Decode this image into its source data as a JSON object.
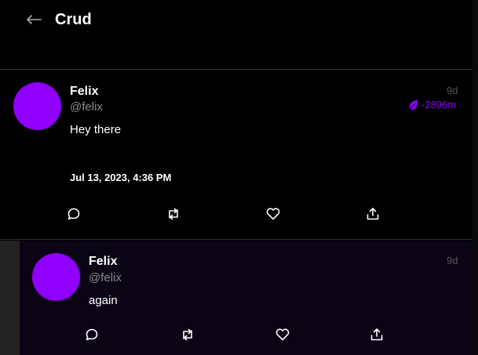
{
  "header": {
    "title": "Crud",
    "back_icon": "arrow-left-icon"
  },
  "post": {
    "author_name": "Felix",
    "author_handle": "@felix",
    "text": "Hey there",
    "age": "9d",
    "score": "-2896m",
    "score_icon": "droplet-icon",
    "timestamp": "Jul 13, 2023, 4:36 PM",
    "actions": [
      "reply-icon",
      "repost-icon",
      "like-icon",
      "share-icon"
    ]
  },
  "reply": {
    "author_name": "Felix",
    "author_handle": "@felix",
    "text": "again",
    "age": "9d",
    "actions": [
      "reply-icon",
      "repost-icon",
      "like-icon",
      "share-icon"
    ]
  },
  "colors": {
    "accent": "#8f00ff",
    "background": "#000000",
    "reply_background": "#0b0414",
    "muted": "#8b8b8b"
  }
}
